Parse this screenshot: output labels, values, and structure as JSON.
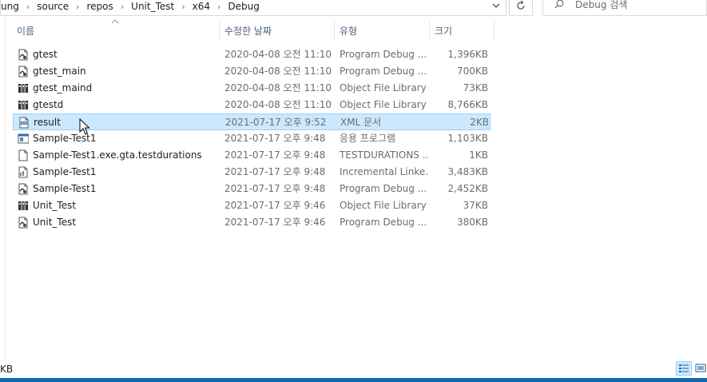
{
  "breadcrumb": [
    "ung",
    "source",
    "repos",
    "Unit_Test",
    "x64",
    "Debug"
  ],
  "search": {
    "placeholder": "Debug 검색"
  },
  "columns": {
    "name": "이름",
    "date": "수정한 날짜",
    "type": "유형",
    "size": "크기"
  },
  "files": [
    {
      "name": "gtest",
      "date": "2020-04-08 오전 11:10",
      "type": "Program Debug ...",
      "size": "1,396KB",
      "icon": "pdb-file-icon"
    },
    {
      "name": "gtest_main",
      "date": "2020-04-08 오전 11:10",
      "type": "Program Debug ...",
      "size": "700KB",
      "icon": "pdb-file-icon"
    },
    {
      "name": "gtest_maind",
      "date": "2020-04-08 오전 11:10",
      "type": "Object File Library",
      "size": "73KB",
      "icon": "lib-file-icon"
    },
    {
      "name": "gtestd",
      "date": "2020-04-08 오전 11:10",
      "type": "Object File Library",
      "size": "8,766KB",
      "icon": "lib-file-icon"
    },
    {
      "name": "result",
      "date": "2021-07-17 오후 9:52",
      "type": "XML 문서",
      "size": "2KB",
      "icon": "xml-file-icon",
      "selected": true
    },
    {
      "name": "Sample-Test1",
      "date": "2021-07-17 오후 9:48",
      "type": "응용 프로그램",
      "size": "1,103KB",
      "icon": "exe-file-icon"
    },
    {
      "name": "Sample-Test1.exe.gta.testdurations",
      "date": "2021-07-17 오후 9:48",
      "type": "TESTDURATIONS ...",
      "size": "1KB",
      "icon": "blank-file-icon"
    },
    {
      "name": "Sample-Test1",
      "date": "2021-07-17 오후 9:48",
      "type": "Incremental Linke...",
      "size": "3,483KB",
      "icon": "ilk-file-icon"
    },
    {
      "name": "Sample-Test1",
      "date": "2021-07-17 오후 9:48",
      "type": "Program Debug ...",
      "size": "2,452KB",
      "icon": "pdb-file-icon"
    },
    {
      "name": "Unit_Test",
      "date": "2021-07-17 오후 9:46",
      "type": "Object File Library",
      "size": "37KB",
      "icon": "lib-file-icon"
    },
    {
      "name": "Unit_Test",
      "date": "2021-07-17 오후 9:46",
      "type": "Program Debug ...",
      "size": "380KB",
      "icon": "pdb-file-icon"
    }
  ],
  "status": {
    "text": "KB"
  },
  "colors": {
    "selection_bg": "#cce8ff",
    "selection_border": "#99d1ff",
    "header_text": "#4c607a",
    "taskbar": "#0b6ab5"
  }
}
